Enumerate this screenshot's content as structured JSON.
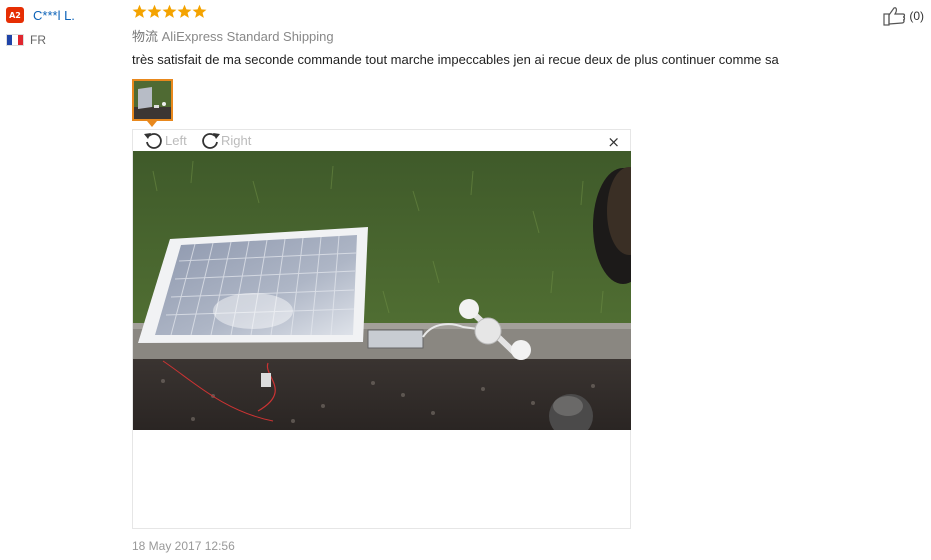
{
  "buyer": {
    "level_badge": "A2",
    "name": "C***l L.",
    "country": "FR",
    "flag_colors": [
      "#1f44a8",
      "#ffffff",
      "#e0272f"
    ]
  },
  "review": {
    "rating": 5,
    "rating_max": 5,
    "star_color": "#f4a300",
    "logistics_label": "物流",
    "shipping_method": "AliExpress Standard Shipping",
    "comment": "très satisfait de ma seconde commande tout marche impeccables jen ai recue deux de plus continuer comme sa",
    "date": "18 May 2017 12:56"
  },
  "viewer": {
    "rotate_left_label": "Left",
    "rotate_right_label": "Right",
    "close_label": "×",
    "icons": [
      "rotate-left-icon",
      "rotate-right-icon",
      "close-icon"
    ]
  },
  "helpful": {
    "count": "(0)",
    "icon": "thumbs-up-icon"
  },
  "colors": {
    "accent_orange": "#e8881d",
    "link_blue": "#0d63b8",
    "badge_red": "#e62e04"
  }
}
